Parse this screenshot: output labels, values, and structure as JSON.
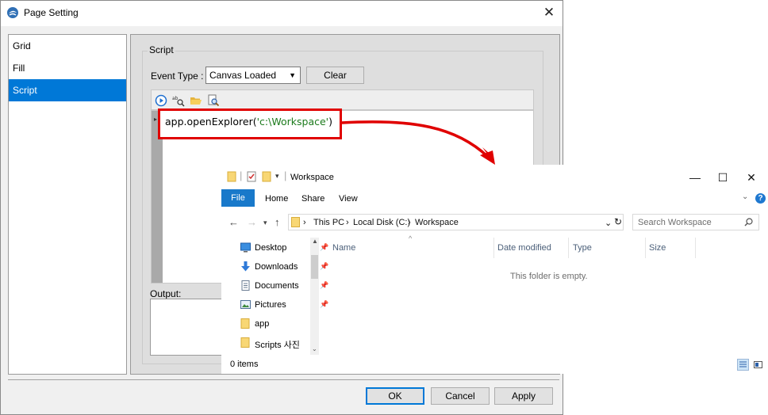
{
  "dialog": {
    "title": "Page Setting",
    "close_glyph": "✕",
    "sidebar": {
      "items": [
        {
          "label": "Grid"
        },
        {
          "label": "Fill"
        },
        {
          "label": "Script",
          "active": true
        }
      ]
    },
    "script_group": {
      "title": "Script",
      "event_type_label": "Event Type :",
      "event_type_value": "Canvas Loaded",
      "clear_label": "Clear",
      "code_prefix": "app.openExplorer(",
      "code_string": "'c:\\Workspace'",
      "code_suffix": ")",
      "output_label": "Output:"
    },
    "buttons": {
      "ok": "OK",
      "cancel": "Cancel",
      "apply": "Apply"
    }
  },
  "explorer": {
    "title": "Workspace",
    "ribbon": {
      "file": "File",
      "home": "Home",
      "share": "Share",
      "view": "View",
      "help_glyph": "?"
    },
    "address": {
      "crumbs": [
        "This PC",
        "Local Disk (C:)",
        "Workspace"
      ]
    },
    "search_placeholder": "Search Workspace",
    "nav_items": [
      {
        "label": "Desktop",
        "icon": "desktop-icon",
        "pinned": true
      },
      {
        "label": "Downloads",
        "icon": "download-icon",
        "pinned": true
      },
      {
        "label": "Documents",
        "icon": "documents-icon",
        "pinned": true
      },
      {
        "label": "Pictures",
        "icon": "pictures-icon",
        "pinned": true
      },
      {
        "label": "app",
        "icon": "folder-icon",
        "pinned": false
      },
      {
        "label": "Scripts 사진",
        "icon": "folder-icon",
        "pinned": false
      }
    ],
    "columns": [
      "Name",
      "Date modified",
      "Type",
      "Size"
    ],
    "empty_message": "This folder is empty.",
    "status": "0 items"
  },
  "colors": {
    "accent": "#0078d7",
    "highlight_red": "#e00000",
    "folder_yellow": "#f8d775",
    "string_green": "#1c7a1c"
  }
}
